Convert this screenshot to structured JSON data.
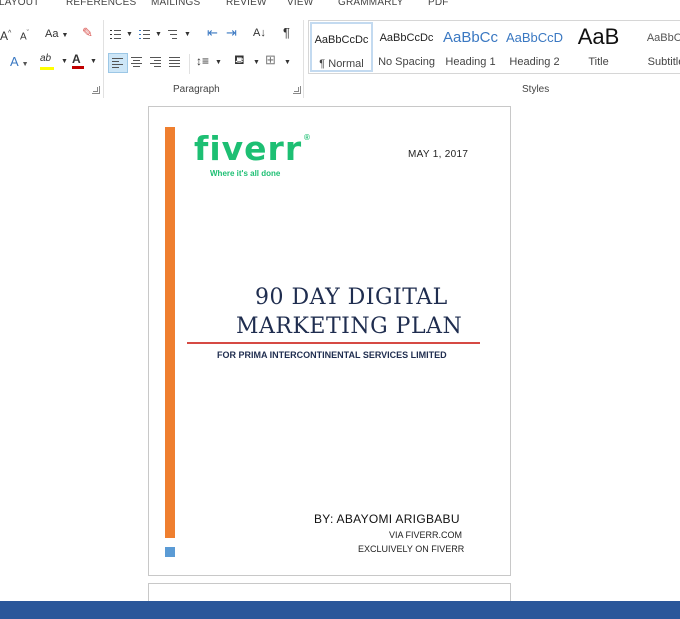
{
  "menu": {
    "tabs": [
      "LAYOUT",
      "REFERENCES",
      "MAILINGS",
      "REVIEW",
      "VIEW",
      "GRAMMARLY",
      "PDF"
    ]
  },
  "ribbon": {
    "font_group": {
      "grow_font": "A",
      "shrink_font": "A",
      "change_case": "Aa",
      "text_effects": "A",
      "highlight": "ab",
      "font_color": "A"
    },
    "paragraph_group": {
      "label": "Paragraph",
      "sort": "A↓",
      "pilcrow": "¶"
    },
    "styles_group": {
      "label": "Styles",
      "items": [
        {
          "preview": "AaBbCcDc",
          "name": "¶ Normal",
          "active": true
        },
        {
          "preview": "AaBbCcDc",
          "name": "No Spacing",
          "active": false
        },
        {
          "preview": "AaBbCc",
          "name": "Heading 1",
          "active": false
        },
        {
          "preview": "AaBbCcD",
          "name": "Heading 2",
          "active": false
        },
        {
          "preview": "AaB",
          "name": "Title",
          "active": false
        },
        {
          "preview": "AaBbCc",
          "name": "Subtitle",
          "active": false
        }
      ]
    }
  },
  "document": {
    "logo_text": "fiverr",
    "logo_mark": "®",
    "tagline": "Where it's all done",
    "date": "MAY 1, 2017",
    "title_line1": "90 DAY DIGITAL",
    "title_line2": "MARKETING PLAN",
    "subtitle": "FOR PRIMA INTERCONTINENTAL SERVICES LIMITED",
    "author": "BY: ABAYOMI ARIGBABU",
    "via": "VIA FIVERR.COM",
    "exclusive": "EXCLUIVELY ON FIVERR"
  },
  "colors": {
    "accent_orange": "#ef7f2f",
    "accent_blue": "#5b9bd5",
    "fiverr_green": "#1dbf73",
    "title_navy": "#1f2d4f",
    "title_rule_red": "#d64a44",
    "statusbar_blue": "#2b579a"
  }
}
